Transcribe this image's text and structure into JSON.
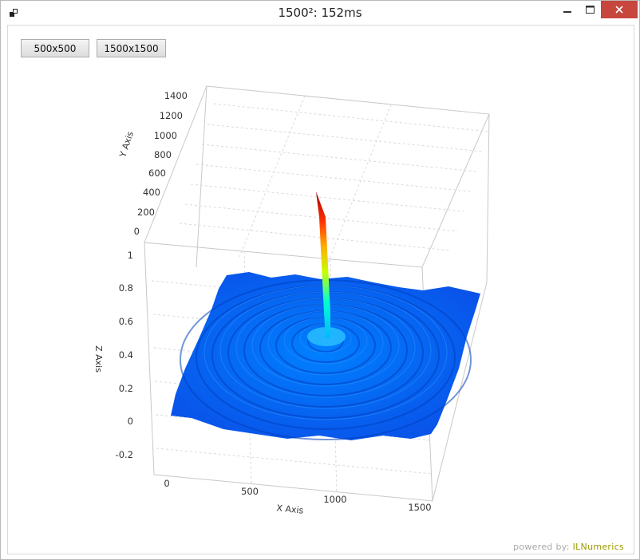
{
  "window": {
    "title": "1500²: 152ms",
    "icon": "app-window-icon",
    "controls": {
      "minimize": "minimize-icon",
      "maximize": "maximize-icon",
      "close": "close-icon",
      "close_color": "#c7463d"
    }
  },
  "toolbar": {
    "button_500_label": "500x500",
    "button_1500_label": "1500x1500"
  },
  "plot": {
    "x_axis_label": "X Axis",
    "y_axis_label": "Y Axis",
    "z_axis_label": "Z Axis",
    "surface_colormap": "jet",
    "surface_base_color": "#0a5cf0",
    "peak_color": "#a00000"
  },
  "chart_data": {
    "type": "surface3d",
    "description_of_function": "radial sinc-like ripple centered at (750,750), peak 1.0",
    "x_ticks": [
      "0",
      "500",
      "1000",
      "1500"
    ],
    "y_ticks": [
      "0",
      "200",
      "400",
      "600",
      "800",
      "1000",
      "1200",
      "1400"
    ],
    "z_ticks": [
      "-0.2",
      "0",
      "0.2",
      "0.4",
      "0.6",
      "0.8",
      "1"
    ],
    "xlim": [
      0,
      1500
    ],
    "ylim": [
      0,
      1500
    ],
    "zlim": [
      -0.2,
      1
    ],
    "peak": {
      "x": 750,
      "y": 750,
      "z": 1.0
    },
    "grid": true
  },
  "footer": {
    "powered_prefix": "powered by: ",
    "powered_brand": "ILNumerics"
  }
}
